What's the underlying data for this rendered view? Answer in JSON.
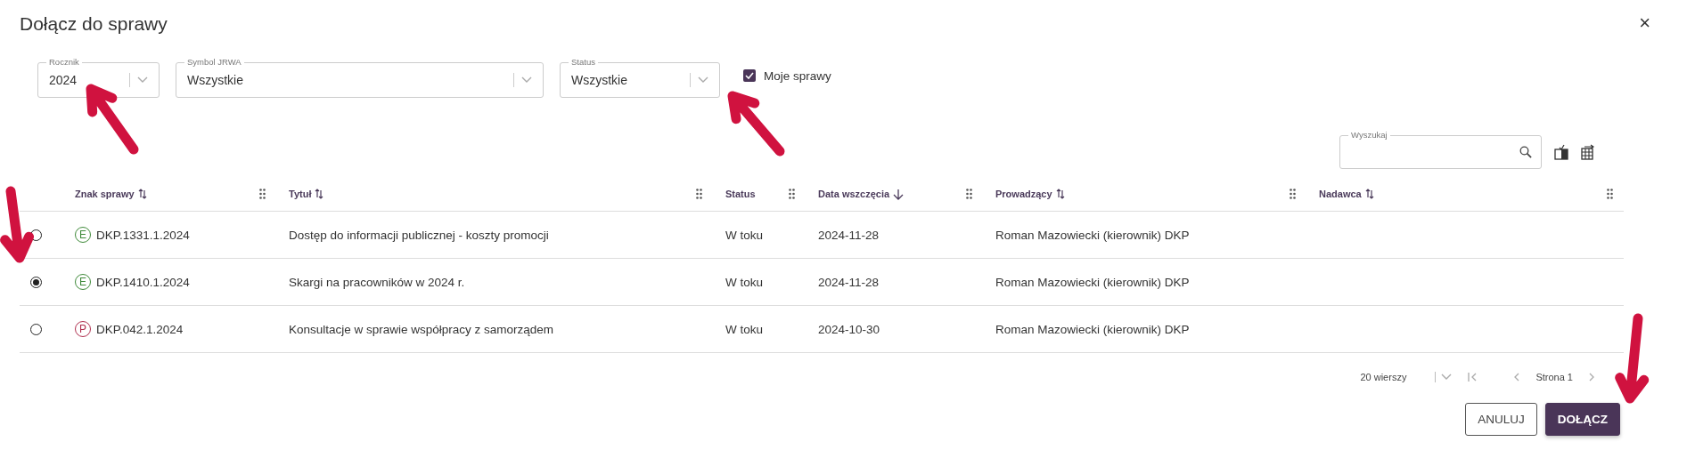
{
  "dialog": {
    "title": "Dołącz do sprawy",
    "close": "×"
  },
  "filters": [
    {
      "kind": "select",
      "label": "Rocznik",
      "value": "2024"
    },
    {
      "kind": "select",
      "label": "Symbol JRWA",
      "value": "Wszystkie"
    },
    {
      "kind": "select",
      "label": "Status",
      "value": "Wszystkie"
    },
    {
      "kind": "checkbox",
      "label": "Moje sprawy",
      "checked": true
    }
  ],
  "search": {
    "label": "Wyszukaj"
  },
  "table": {
    "columns": [
      {
        "label": "Znak sprawy",
        "sortable": true,
        "sorted": false
      },
      {
        "label": "Tytuł",
        "sortable": true,
        "sorted": false
      },
      {
        "label": "Status",
        "sortable": false,
        "sorted": false
      },
      {
        "label": "Data wszczęcia",
        "sortable": true,
        "sorted": true
      },
      {
        "label": "Prowadzący",
        "sortable": true,
        "sorted": false
      },
      {
        "label": "Nadawca",
        "sortable": true,
        "sorted": false
      }
    ],
    "rows": [
      {
        "selected": false,
        "badge": "E",
        "color": "#3f8a3a",
        "cells": [
          "DKP.1331.1.2024",
          "Dostęp do informacji publicznej - koszty promocji",
          "W toku",
          "2024-11-28",
          "Roman Mazowiecki (kierownik) DKP",
          ""
        ]
      },
      {
        "selected": true,
        "badge": "E",
        "color": "#3f8a3a",
        "cells": [
          "DKP.1410.1.2024",
          "Skargi na pracowników w 2024 r.",
          "W toku",
          "2024-11-28",
          "Roman Mazowiecki (kierownik) DKP",
          ""
        ]
      },
      {
        "selected": false,
        "badge": "P",
        "color": "#b0304f",
        "cells": [
          "DKP.042.1.2024",
          "Konsultacje w sprawie współpracy z samorządem",
          "W toku",
          "2024-10-30",
          "Roman Mazowiecki (kierownik) DKP",
          ""
        ]
      }
    ]
  },
  "pager": {
    "rows_per_page": "20 wierszy",
    "page": "Strona 1"
  },
  "buttons": [
    {
      "label": "ANULUJ",
      "kind": "secondary"
    },
    {
      "label": "DOŁĄCZ",
      "kind": "primary"
    }
  ]
}
